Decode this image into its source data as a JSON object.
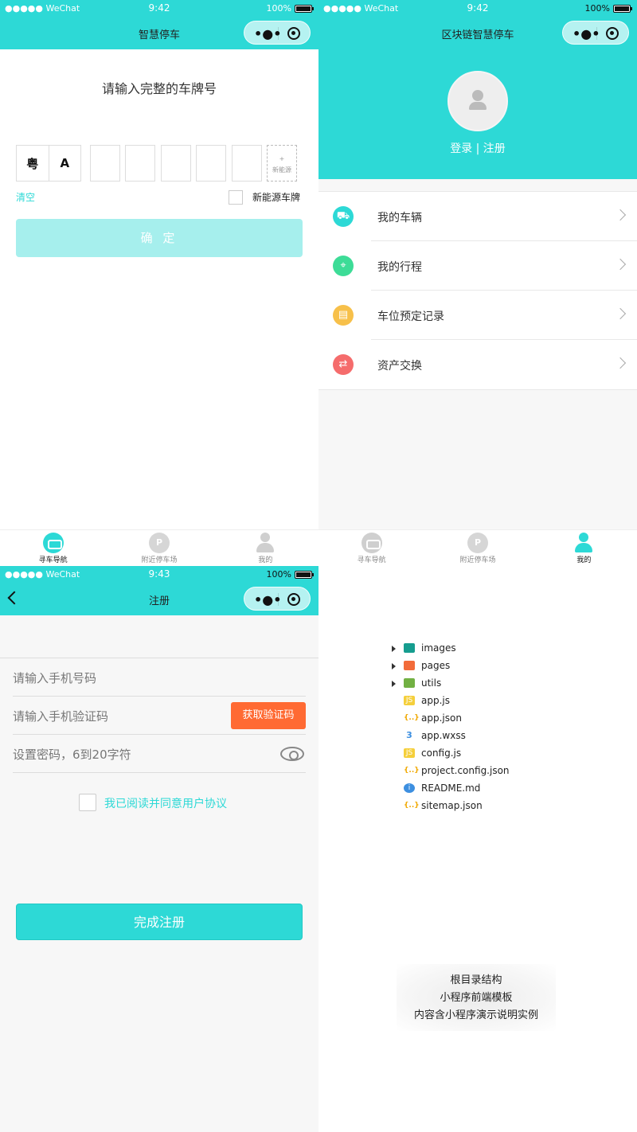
{
  "status": {
    "carrier": "●●●●● WeChat",
    "battery": "100%",
    "times": {
      "plate": "9:42",
      "mine": "9:42",
      "reg": "9:43"
    }
  },
  "plate_page": {
    "title": "智慧停车",
    "heading": "请输入完整的车牌号",
    "province": "粤",
    "letter": "A",
    "new_energy_hint": "新能源",
    "new_energy_plus": "+",
    "clear": "清空",
    "ev_plate_label": "新能源车牌",
    "confirm": "确 定"
  },
  "tabbar": {
    "items": [
      {
        "label": "寻车导航",
        "icon": "car-navigation-icon"
      },
      {
        "label": "附近停车场",
        "icon": "parking-icon"
      },
      {
        "label": "我的",
        "icon": "user-icon"
      }
    ],
    "active_left": 0,
    "active_right": 2
  },
  "mine_page": {
    "title": "区块链智慧停车",
    "login": "登录 | 注册",
    "menu": [
      {
        "label": "我的车辆",
        "icon": "car-icon",
        "color": "#2dd9d6"
      },
      {
        "label": "我的行程",
        "icon": "location-pin-icon",
        "color": "#3ddc97"
      },
      {
        "label": "车位预定记录",
        "icon": "calendar-icon",
        "color": "#f7c04a"
      },
      {
        "label": "资产交换",
        "icon": "exchange-icon",
        "color": "#f56c6c"
      }
    ]
  },
  "register_page": {
    "title": "注册",
    "phone_placeholder": "请输入手机号码",
    "code_placeholder": "请输入手机验证码",
    "get_code": "获取验证码",
    "password_placeholder": "设置密码，6到20字符",
    "agreement": "我已阅读并同意用户协议",
    "submit": "完成注册"
  },
  "file_tree": {
    "items": [
      {
        "name": "images",
        "type": "folder",
        "icon": "folder-images-icon"
      },
      {
        "name": "pages",
        "type": "folder",
        "icon": "folder-pages-icon"
      },
      {
        "name": "utils",
        "type": "folder",
        "icon": "folder-utils-icon"
      },
      {
        "name": "app.js",
        "type": "js",
        "icon": "js-file-icon"
      },
      {
        "name": "app.json",
        "type": "json",
        "icon": "json-file-icon"
      },
      {
        "name": "app.wxss",
        "type": "wxss",
        "icon": "css-file-icon"
      },
      {
        "name": "config.js",
        "type": "js",
        "icon": "js-file-icon"
      },
      {
        "name": "project.config.json",
        "type": "json",
        "icon": "json-file-icon"
      },
      {
        "name": "README.md",
        "type": "md",
        "icon": "info-icon"
      },
      {
        "name": "sitemap.json",
        "type": "json",
        "icon": "json-file-icon"
      }
    ],
    "caption": [
      "根目录结构",
      "小程序前端模板",
      "内容含小程序演示说明实例"
    ]
  }
}
